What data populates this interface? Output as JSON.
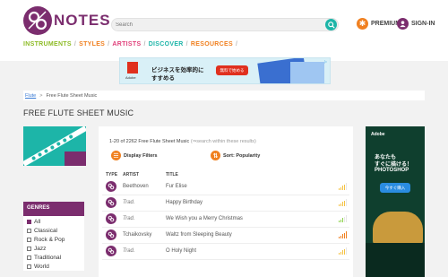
{
  "brand": {
    "name": "NOTES"
  },
  "search": {
    "placeholder": "Search"
  },
  "header": {
    "premium_label": "PREMIUM",
    "signin_label": "SIGN-IN"
  },
  "nav": [
    {
      "label": "INSTRUMENTS",
      "color": "#8dbb25"
    },
    {
      "label": "STYLES",
      "color": "#f08020"
    },
    {
      "label": "ARTISTS",
      "color": "#e0407a"
    },
    {
      "label": "DISCOVER",
      "color": "#1db5a8"
    },
    {
      "label": "RESOURCES",
      "color": "#f08020"
    }
  ],
  "ad_top": {
    "brand": "Adobe",
    "line1": "ビジネスを効率的に",
    "line2": "すすめる",
    "cta": "無料で始める"
  },
  "breadcrumb": {
    "root": "Flute",
    "sep": ">",
    "current": "Free Flute Sheet Music"
  },
  "page": {
    "title": "FREE FLUTE SHEET MUSIC"
  },
  "genres": {
    "heading": "GENRES",
    "items": [
      {
        "label": "All",
        "checked": true
      },
      {
        "label": "Classical",
        "checked": false
      },
      {
        "label": "Rock & Pop",
        "checked": false
      },
      {
        "label": "Jazz",
        "checked": false
      },
      {
        "label": "Traditional",
        "checked": false
      },
      {
        "label": "World",
        "checked": false
      }
    ]
  },
  "results": {
    "count_text": "1-20 of 2262 Free Flute Sheet Music",
    "search_within": "(⇒search within these results)",
    "display_filters": "Display Filters",
    "sort_label": "Sort: Popularity"
  },
  "table": {
    "headers": {
      "type": "TYPE",
      "artist": "ARTIST",
      "title": "TITLE"
    },
    "rows": [
      {
        "artist": "Beethoven",
        "italic": false,
        "title": "Fur Elise",
        "difficulty": 2,
        "diff_color": "#f5c242"
      },
      {
        "artist": "Trad.",
        "italic": true,
        "title": "Happy Birthday",
        "difficulty": 2,
        "diff_color": "#f5c242"
      },
      {
        "artist": "Trad.",
        "italic": true,
        "title": "We Wish you a Merry Christmas",
        "difficulty": 1,
        "diff_color": "#8dd24a"
      },
      {
        "artist": "Tchaikovsky",
        "italic": false,
        "title": "Waltz from Sleeping Beauty",
        "difficulty": 3,
        "diff_color": "#f08020"
      },
      {
        "artist": "Trad.",
        "italic": true,
        "title": "O Holy Night",
        "difficulty": 2,
        "diff_color": "#f5c242"
      }
    ]
  },
  "ad_side": {
    "brand": "Adobe",
    "line1": "あなたも",
    "line2": "すぐに描ける！",
    "product": "PHOTOSHOP",
    "cta": "今すぐ購入"
  }
}
